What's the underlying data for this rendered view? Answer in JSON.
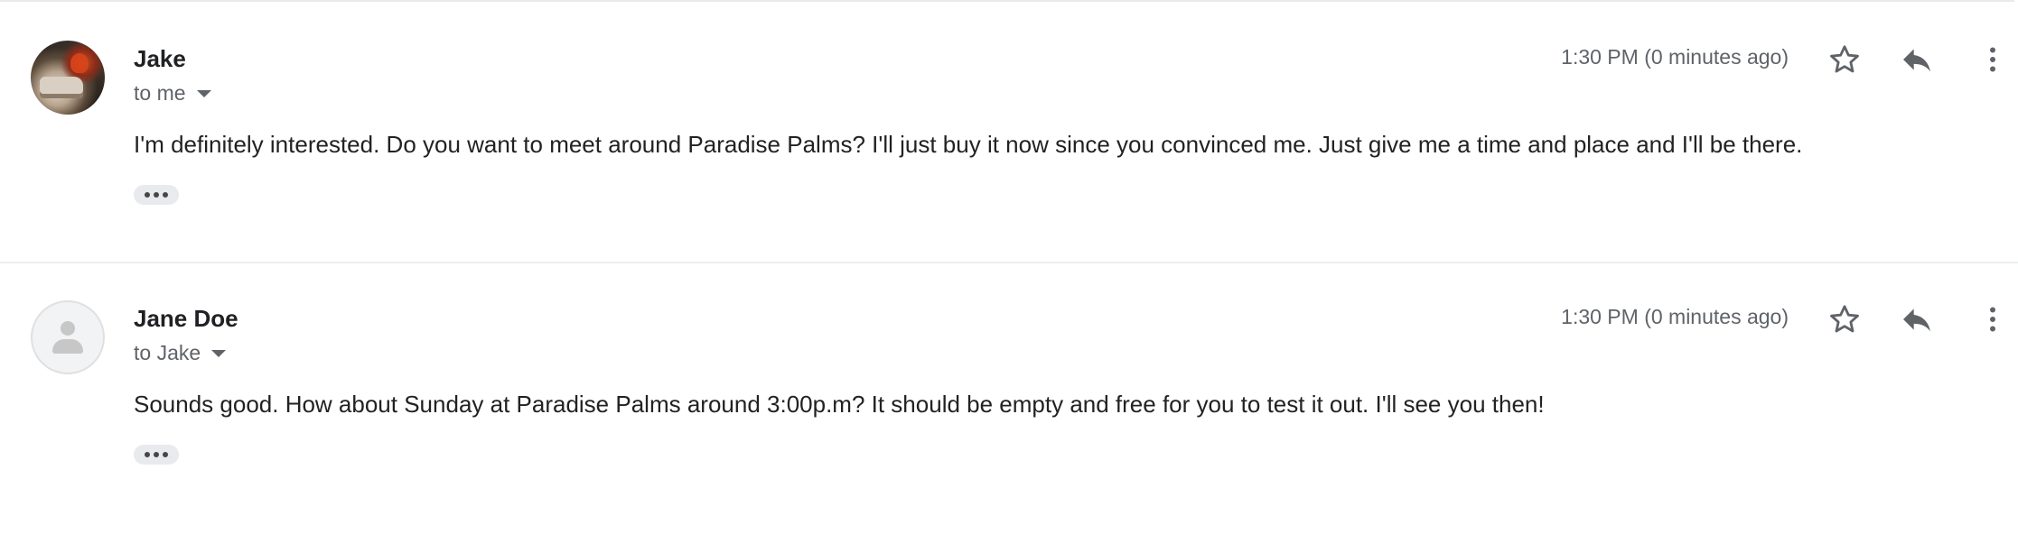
{
  "messages": [
    {
      "sender": "Jake",
      "recipient": "to me",
      "timestamp": "1:30 PM (0 minutes ago)",
      "body": "I'm definitely interested. Do you want to meet around Paradise Palms? I'll just buy it now since you convinced me. Just give me a time and place and I'll be there.",
      "avatar": "photo-avatar"
    },
    {
      "sender": "Jane Doe",
      "recipient": "to Jake",
      "timestamp": "1:30 PM (0 minutes ago)",
      "body": "Sounds good. How about Sunday at Paradise Palms around 3:00p.m? It should be empty and free for you to test it out. I'll see you then!",
      "avatar": "default-person-avatar"
    }
  ],
  "icons": {
    "star": "star-outline-icon",
    "reply": "reply-arrow-icon",
    "more": "more-vertical-icon",
    "trimmed": "more-horizontal-icon",
    "recipient_details": "caret-down-icon"
  },
  "colors": {
    "sender_text": "#202124",
    "secondary_text": "#5f6368",
    "body_text": "#222222",
    "divider": "#e8eaed",
    "icon": "#5f6368"
  }
}
